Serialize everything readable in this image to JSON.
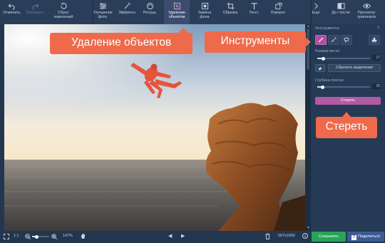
{
  "toolbar": {
    "undo": "Отменить",
    "redo": "Повторить",
    "reset": "Сброс\nизменений",
    "enhance": "Улучшение\nфото",
    "effects": "Эффекты",
    "retouch": "Ретушь",
    "object_removal": "Удаление\nобъектов",
    "bg_replace": "Замена\nфона",
    "crop": "Обрезка",
    "text": "Текст",
    "rotate": "Поворот",
    "more": "Ещё",
    "before_after": "До / после",
    "view_original": "Просмотр\nоригинала"
  },
  "panel": {
    "tools_label": "Инструменты",
    "help": "?",
    "brush_size_label": "Размер кисти:",
    "brush_size": "17",
    "brush_size_fraction": 0.12,
    "reset_selection": "Сбросить выделение",
    "search_depth_label": "Глубина поиска:",
    "search_depth": "15",
    "search_depth_fraction": 0.1,
    "erase": "Стереть"
  },
  "statusbar": {
    "ratio": "1:1",
    "zoom": "147%",
    "zoom_fraction": 0.28,
    "dimensions": "667x1000",
    "save": "Сохранить",
    "share": "Поделиться"
  },
  "callouts": {
    "object_removal": "Удаление объектов",
    "tools": "Инструменты",
    "erase": "Стереть"
  },
  "colors": {
    "accent": "#ef6a4b",
    "active_tool": "#b04f9f",
    "save": "#27a555",
    "share": "#3b5b94"
  }
}
